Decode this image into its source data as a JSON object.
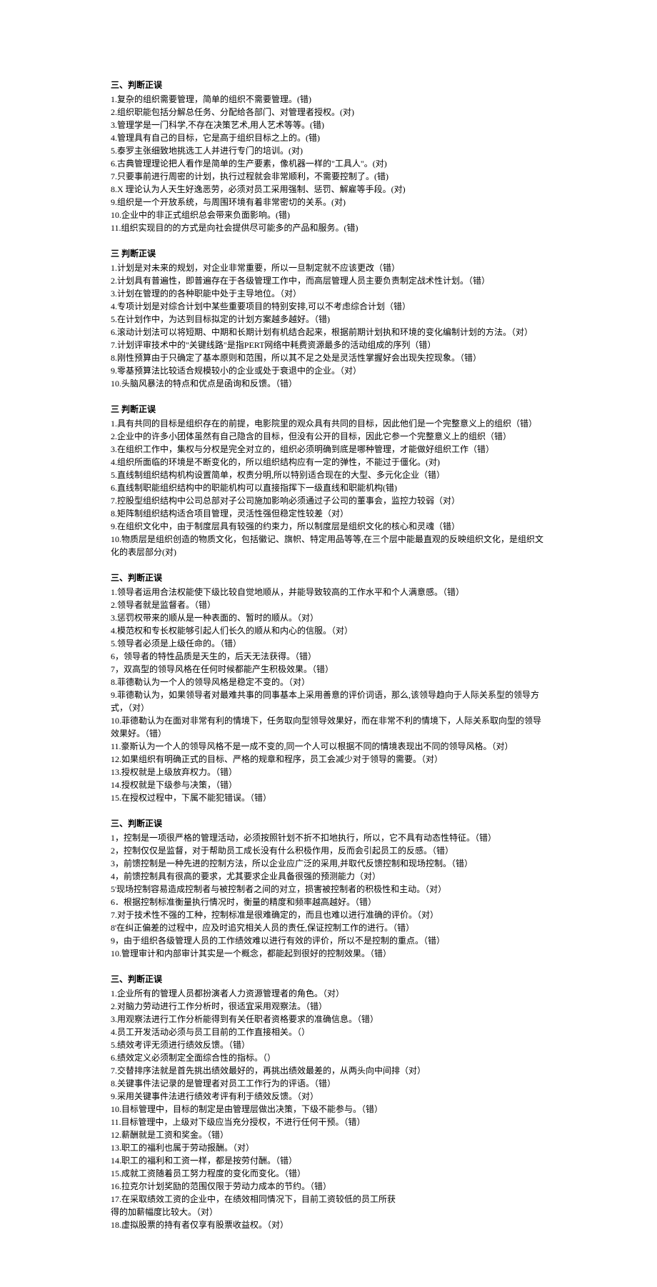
{
  "sections": [
    {
      "title": "三、判断正误",
      "items": [
        "1.复杂的组织需要管理，简单的组织不需要管理。(错)",
        "2.组织职能包括分解总任务、分配给各部门、对管理者授权。(对)",
        "3.管理学是一门科学,不存在决策艺术,用人艺术等等。(错)",
        "4.管理具有自己的目标，它是高于组织目标之上的。(错)",
        "5.泰罗主张细致地挑选工人并进行专门的培训。(对)",
        "6.古典管理理论把人看作是简单的生产要素，像机器一样的\"工具人\"。(对)",
        "7.只要事前进行周密的计划，执行过程就会非常顺利，不需要控制了。(错)",
        "8.X 理论认为人天生好逸恶劳，必须对员工采用强制、惩罚、解雇等手段。(对)",
        "9.组织是一个开放系统，与周围环境有着非常密切的关系。(对)",
        "10.企业中的非正式组织总会带来负面影响。(错)",
        "11.组织实现目的的方式是向社会提供尽可能多的产品和服务。(错)"
      ]
    },
    {
      "title": "三 判断正误",
      "items": [
        "1.计划是对未来的规划，对企业非常重要，所以一旦制定就不应该更改（错）",
        "2.计划具有普遍性，即普遍存在于各级管理工作中，而高层管理人员主要负责制定战术性计划。（错）",
        "3.计划在管理的的各种职能中处于主导地位。（对）",
        "4.专项计划是对综合计划中某些重要项目的特别安排,可以不考虑综合计划（错）",
        "5.在计划作中，为达到目标拟定的计划方案越多越好。（错)",
        "6.滚动计划法可以将短期、中期和长期计划有机结合起来，根据前期计划执和环境的变化编制计划的方法。（对）",
        "7.计划评审技术中的\"关键线路\"是指PERT网络中耗费资源最多的活动组成的序列（错）",
        "8.刚性预算由于只确定了基本原则和范围，所以其不足之处是灵活性掌握好会出现失控现象。（错）",
        "9.零基预算法比较适合规模较小的企业或处于衰退中的企业。（对）",
        "10.头脑风暴法的特点和优点是函询和反馈。（错）"
      ]
    },
    {
      "title": "三 判断正误",
      "items": [
        "1.具有共同的目标是组织存在的前提，电影院里的观众具有共同的目标，因此他们是一个完整意义上的组织（错）",
        "2.企业中的许多小团体虽然有自己隐含的目标，但没有公开的目标，因此它参一个完整意义上的组织（错）",
        "3.在组织工作中，集权与分权是完全对立的，组织必须明确到底是哪种管理，才能做好组织工作（错）",
        "4.组织所面临的环境是不断变化的，所以组织结构应有一定的弹性，不能过于僵化。(对)",
        "5.直线制组织结构机构设置简单，权责分明,所以特别适合现在的大型、多元化企业（错）",
        "6.直线制职能组织结构中的职能机构可以直接指挥下一级直线和职能机构(错)",
        "7.控股型组织结构中公司总部对子公司施加影响必须通过子公司的董事会，监控力较弱（对）",
        "8.矩阵制组织结构适合项目管理，灵活性强但稳定性较差（对）",
        "9.在组织文化中，由于制度层具有较强的约束力，所以制度层是组织文化的核心和灵魂（错）",
        "10.物质层是组织创造的物质文化，包括徽记、旗帜、特定用品等等,在三个层中能最直观的反映组织文化，是组织文化的表层部分(对)"
      ]
    },
    {
      "title": "三、判断正误",
      "items": [
        "1.领导者运用合法权能使下级比较自觉地顺从，并能导致较高的工作水平和个人满意感。（错）",
        "2.领导者就是监督者。（错）",
        "3.惩罚权带来的顺从是一种表面的、暂时的顺从。（对）",
        "4.模范权和专长权能够引起人们长久的顺从和内心的信服。（对）",
        "5.领导者必须是上级任命的。（错）",
        "6，领导者的特性品质是天生的，后天无法获得。（错）",
        "7，双高型的领导风格在任何时候都能产生积极效果。（错）",
        "8.菲德勒认为一个人的领导风格是稳定不变的。（对）",
        "9.菲德勒认为，如果领导者对最难共事的同事基本上采用善意的评价词语，那么,该领导趋向于人际关系型的领导方式，（对）",
        "10.菲德勒认为在面对非常有利的情境下，任务取向型领导效果好，而在非常不利的情境下，人际关系取向型的领导效果好。（错）",
        "11.豪斯认为一个人的领导风格不是一成不变的,同一个人可以根据不同的情境表现出不同的领导风格。（对）",
        "12.如果组织有明确正式的目标、严格的规章和程序，员工会减少对于领导的需要。（对）",
        "13.授权就是上级放弃权力。（错）",
        "14.授权就是下级参与决策，（错）",
        "15.在授权过程中，下属不能犯错误。（错）"
      ]
    },
    {
      "title": "三、判断正误",
      "items": [
        "1，控制是一项很严格的管理活动，必须按照针划不折不扣地执行，所以，它不具有动态性特征。（错）",
        "2，控制仅仅是监督，对于帮助员工成长没有什么积极作用，反而会引起员工的反感。（错）",
        "3，前馈控制是一种先进的控制方法，所以企业应广泛的采用,并取代反馈控制和现场控制。（错）",
        "4，前馈控制具有很高的要求，尤其要求企业具备很强的预测能力（对）",
        "5'现场控制容易造成控制者与被控制者之间的对立，损害被控制者的积极性和主动。（对）",
        "6．根据控制标准衡量执行情况时，衡量的精度和频率越高越好。（错）",
        "7.对于技术性不强的工种，控制标准是很难确定的，而且也难以进行准确的评价。（对）",
        "8'在纠正偏差的过程中，应及时追究相关人员的责任,保证控制工作的进行。（错）",
        "9，由于组织各级管理人员的工作绩效难以进行有效的评价，所以不是控制的重点。（错）",
        "10.管理审计和内部审计其实是一个概念，都能起到很好的控制效果。（错）"
      ]
    },
    {
      "title": "三、判断正误",
      "items": [
        "1.企业所有的管理人员都扮演者人力资源管理者的角色。（对）",
        "2.对脑力劳动进行工作分析时，很适宜采用观察法。（错）",
        "3.用观察法进行工作分析能得到有关任职者资格要求的准确信息。（错）",
        "4.员工开发活动必须与员工目前的工作直接相关。（）",
        "5.绩效考评无须进行绩效反馈。（错）",
        "6.绩效定义必须制定全面综合性的指标。（）",
        "7.交替排序法就是首先挑出绩效最好的，再挑出绩效最差的，从两头向中间排（对）",
        "8.关键事件法记录的是管理者对员工工作行为的评语。（错）",
        "9.采用关键事件法进行绩效考评有利于绩效反馈。（对）",
        "10.目标管理中，目标的制定是由管理层做出决策，下级不能参与。（错）",
        "11.目标管理中，上级对下级应当充分授权，不进行任何干预。（错）",
        "12.薪酬就是工资和奖金。（错）",
        "13.职工的福利也属于劳动报酬。（对）",
        "14.职工的福利和工资一样，都是按劳付酬。（错）",
        "15.成就工资随着员工努力程度的变化而变化。（错）",
        "16.拉克尔计划奖励的范围仅限于劳动力成本的节约。（错）",
        "17.在采取绩效工资的企业中，在绩效相同情况下，目前工资较低的员工所获",
        "得的加薪幅度比较大。（对）",
        "18.虚拟股票的持有者仅享有股票收益权。（对）"
      ]
    }
  ]
}
